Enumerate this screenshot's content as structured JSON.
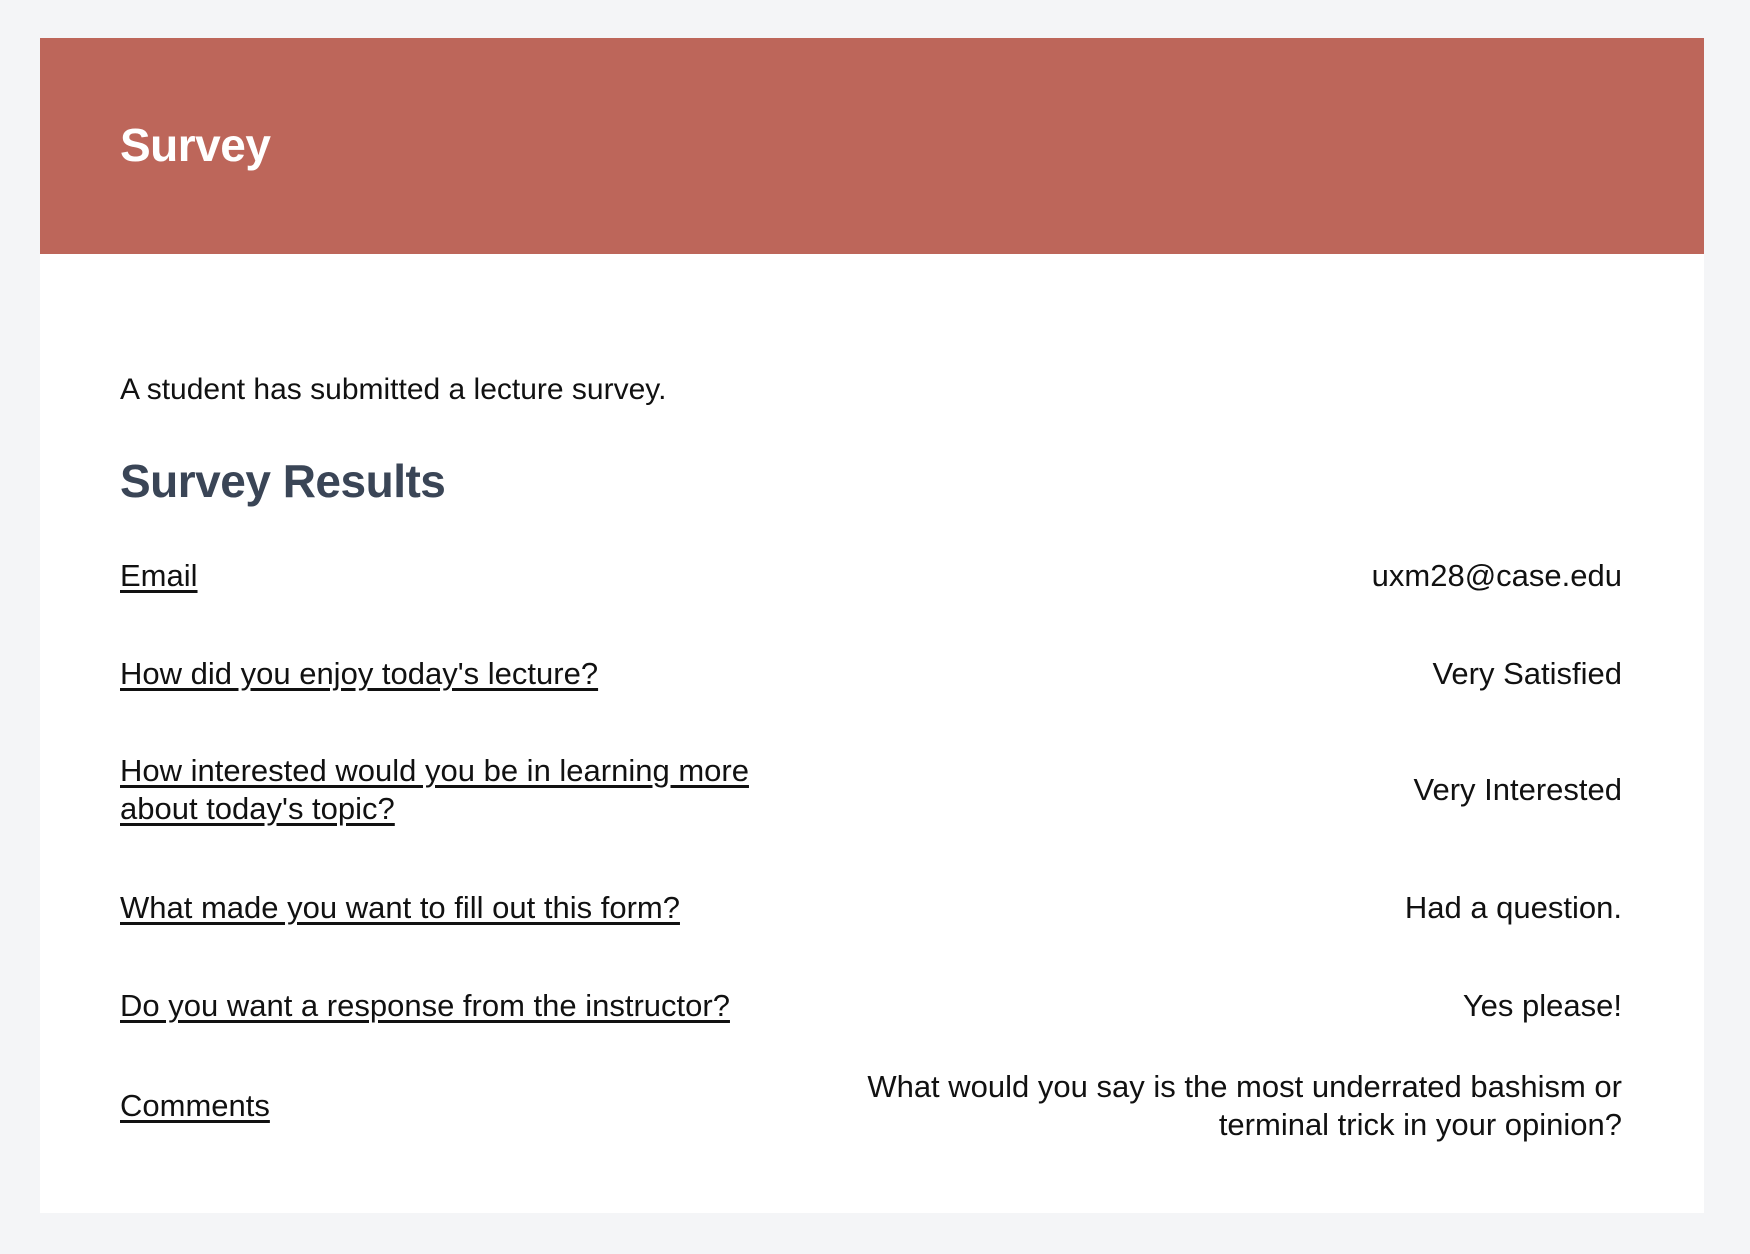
{
  "header": {
    "title": "Survey"
  },
  "intro": "A student has submitted a lecture survey.",
  "results": {
    "heading": "Survey Results",
    "rows": [
      {
        "question": "Email",
        "answer": "uxm28@case.edu"
      },
      {
        "question": "How did you enjoy today's lecture?",
        "answer": "Very Satisfied"
      },
      {
        "question": "How interested would you be in learning more about today's topic?",
        "answer": "Very Interested"
      },
      {
        "question": "What made you want to fill out this form?",
        "answer": "Had a question."
      },
      {
        "question": "Do you want a response from the instructor?",
        "answer": "Yes please!"
      },
      {
        "question": "Comments",
        "answer": "What would you say is the most underrated bashism or terminal trick in your opinion?"
      }
    ]
  },
  "colors": {
    "banner": "#bd665a",
    "heading": "#3a4556",
    "page_background": "#f4f5f7"
  }
}
